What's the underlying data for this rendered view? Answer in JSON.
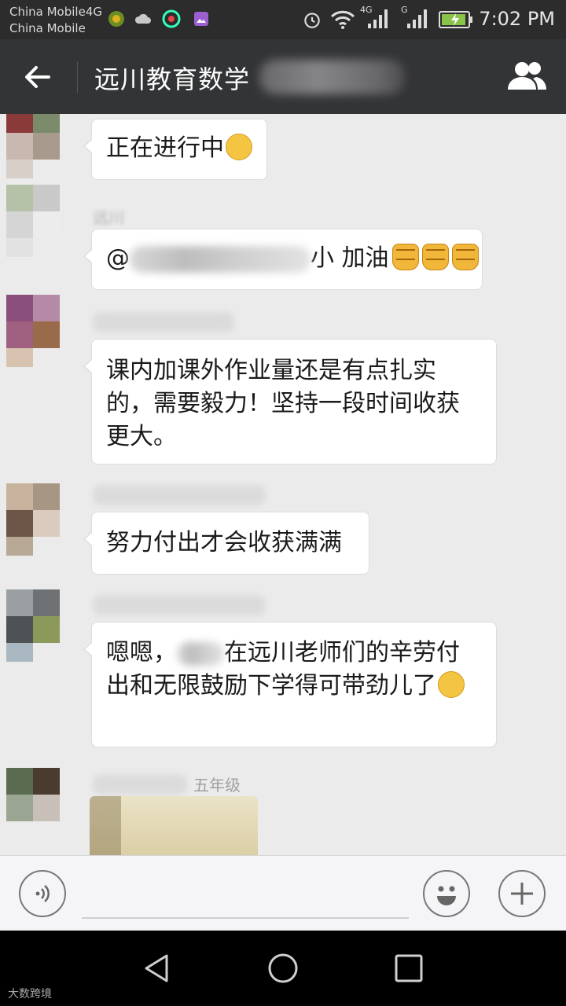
{
  "status_bar": {
    "carrier1": "China Mobile4G",
    "carrier2": "China Mobile",
    "network1": "4G",
    "network2": "G",
    "time": "7:02 PM",
    "icons": [
      "app-icon",
      "cloud-icon",
      "browser-icon",
      "gallery-icon",
      "alarm-icon",
      "wifi-icon",
      "signal-icon",
      "signal-icon",
      "battery-charging-icon"
    ]
  },
  "header": {
    "back_icon": "arrow-left-icon",
    "title": "远川教育数学",
    "group_icon": "group-members-icon"
  },
  "messages": [
    {
      "id": "m1",
      "text": "正在进行中",
      "emoji": "thinking-face"
    },
    {
      "id": "m2",
      "sender": "远川",
      "prefix": "@",
      "mid": "小 加油",
      "emoji": [
        "fist",
        "fist",
        "fist"
      ]
    },
    {
      "id": "m3",
      "text": "课内加课外作业量还是有点扎实的，需要毅力！坚持一段时间收获更大。"
    },
    {
      "id": "m4",
      "text": "努力付出才会收获满满"
    },
    {
      "id": "m5",
      "text": "在远川老师们的辛劳付出和无限鼓励下学得可带劲儿了",
      "prefix": "嗯嗯，",
      "emoji": "grinning-face"
    },
    {
      "id": "m6",
      "sender": "五年级",
      "type": "image"
    }
  ],
  "input_bar": {
    "voice_icon": "voice-icon",
    "emoji_icon": "smile-icon",
    "plus_icon": "plus-icon"
  },
  "nav_bar": {
    "back": "nav-back-icon",
    "home": "nav-home-icon",
    "recent": "nav-recent-icon"
  },
  "watermark": "大数跨境",
  "colors": {
    "title_bg": "#333436",
    "status_bg": "#2c2c2c",
    "chat_bg": "#ebebeb",
    "bubble_bg": "#ffffff"
  }
}
